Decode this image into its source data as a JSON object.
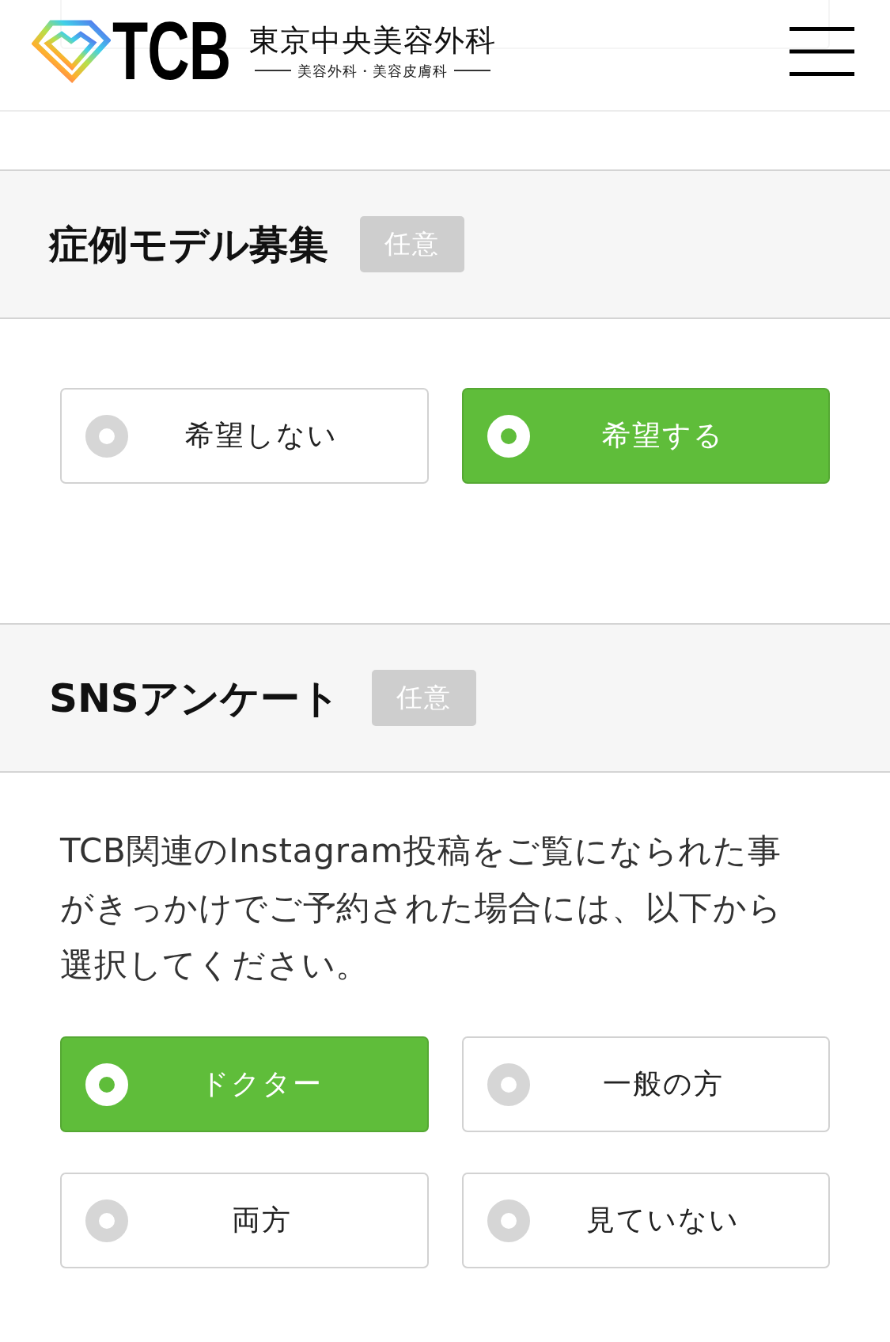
{
  "header": {
    "logo_text": "TCB",
    "clinic_name": "東京中央美容外科",
    "clinic_subtitle": "美容外科・美容皮膚科"
  },
  "sections": [
    {
      "title": "症例モデル募集",
      "badge": "任意",
      "options": [
        {
          "label": "希望しない",
          "selected": false
        },
        {
          "label": "希望する",
          "selected": true
        }
      ]
    },
    {
      "title": "SNSアンケート",
      "badge": "任意",
      "description": "TCB関連のInstagram投稿をご覧になられた事がきっかけでご予約された場合には、以下から選択してください。",
      "options": [
        {
          "label": "ドクター",
          "selected": true
        },
        {
          "label": "一般の方",
          "selected": false
        },
        {
          "label": "両方",
          "selected": false
        },
        {
          "label": "見ていない",
          "selected": false
        }
      ]
    }
  ]
}
